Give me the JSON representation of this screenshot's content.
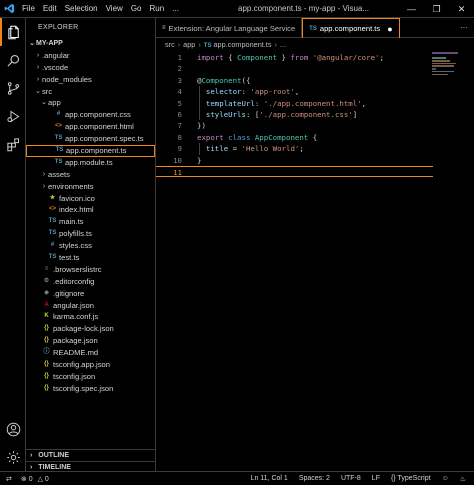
{
  "menu": [
    "File",
    "Edit",
    "Selection",
    "View",
    "Go",
    "Run",
    "..."
  ],
  "window_title": "app.component.ts - my-app - Visua...",
  "explorer": {
    "header": "EXPLORER",
    "root": "MY-APP",
    "items": [
      {
        "label": ".angular",
        "kind": "folder",
        "depth": 1
      },
      {
        "label": ".vscode",
        "kind": "folder",
        "depth": 1
      },
      {
        "label": "node_modules",
        "kind": "folder",
        "depth": 1
      },
      {
        "label": "src",
        "kind": "folder-open",
        "depth": 1
      },
      {
        "label": "app",
        "kind": "folder-open",
        "depth": 2
      },
      {
        "label": "app.component.css",
        "kind": "css",
        "glyph": "#",
        "depth": 3
      },
      {
        "label": "app.component.html",
        "kind": "html",
        "glyph": "<>",
        "depth": 3
      },
      {
        "label": "app.component.spec.ts",
        "kind": "ts",
        "glyph": "TS",
        "depth": 3
      },
      {
        "label": "app.component.ts",
        "kind": "ts",
        "glyph": "TS",
        "depth": 3,
        "selected": true
      },
      {
        "label": "app.module.ts",
        "kind": "ts",
        "glyph": "TS",
        "depth": 3
      },
      {
        "label": "assets",
        "kind": "folder",
        "depth": 2
      },
      {
        "label": "environments",
        "kind": "folder",
        "depth": 2
      },
      {
        "label": "favicon.ico",
        "kind": "fav",
        "glyph": "★",
        "depth": 2
      },
      {
        "label": "index.html",
        "kind": "html",
        "glyph": "<>",
        "depth": 2
      },
      {
        "label": "main.ts",
        "kind": "ts",
        "glyph": "TS",
        "depth": 2
      },
      {
        "label": "polyfills.ts",
        "kind": "ts",
        "glyph": "TS",
        "depth": 2
      },
      {
        "label": "styles.css",
        "kind": "css",
        "glyph": "#",
        "depth": 2
      },
      {
        "label": "test.ts",
        "kind": "ts",
        "glyph": "TS",
        "depth": 2
      },
      {
        "label": ".browserslistrc",
        "kind": "dot",
        "glyph": "≡",
        "depth": 1
      },
      {
        "label": ".editorconfig",
        "kind": "dot",
        "glyph": "⚙",
        "depth": 1
      },
      {
        "label": ".gitignore",
        "kind": "dot",
        "glyph": "◆",
        "depth": 1
      },
      {
        "label": "angular.json",
        "kind": "ng",
        "glyph": "A",
        "depth": 1
      },
      {
        "label": "karma.conf.js",
        "kind": "karma",
        "glyph": "K",
        "depth": 1
      },
      {
        "label": "package-lock.json",
        "kind": "json",
        "glyph": "{}",
        "depth": 1
      },
      {
        "label": "package.json",
        "kind": "json",
        "glyph": "{}",
        "depth": 1
      },
      {
        "label": "README.md",
        "kind": "md",
        "glyph": "ⓘ",
        "depth": 1
      },
      {
        "label": "tsconfig.app.json",
        "kind": "json",
        "glyph": "{}",
        "depth": 1
      },
      {
        "label": "tsconfig.json",
        "kind": "json",
        "glyph": "{}",
        "depth": 1
      },
      {
        "label": "tsconfig.spec.json",
        "kind": "json",
        "glyph": "{}",
        "depth": 1
      }
    ],
    "outline": "OUTLINE",
    "timeline": "TIMELINE"
  },
  "tabs": [
    {
      "label": "Extension: Angular Language Service",
      "icon": "≡",
      "active": false
    },
    {
      "label": "app.component.ts",
      "icon": "TS",
      "active": true
    }
  ],
  "breadcrumb": [
    "src",
    "app",
    "app.component.ts",
    "..."
  ],
  "code": {
    "line_numbers": [
      "1",
      "2",
      "3",
      "4",
      "5",
      "6",
      "7",
      "8",
      "9",
      "10",
      "11"
    ],
    "current_line": "11"
  },
  "status": {
    "position": "Ln 11, Col 1",
    "spaces": "Spaces: 2",
    "encoding": "UTF-8",
    "eol": "LF",
    "language": "TypeScript",
    "errors": "0",
    "warnings": "0"
  },
  "colors": {
    "accent": "#f38518",
    "ts_icon": "#519aba",
    "html_icon": "#e37933",
    "json_icon": "#cbcb41"
  }
}
